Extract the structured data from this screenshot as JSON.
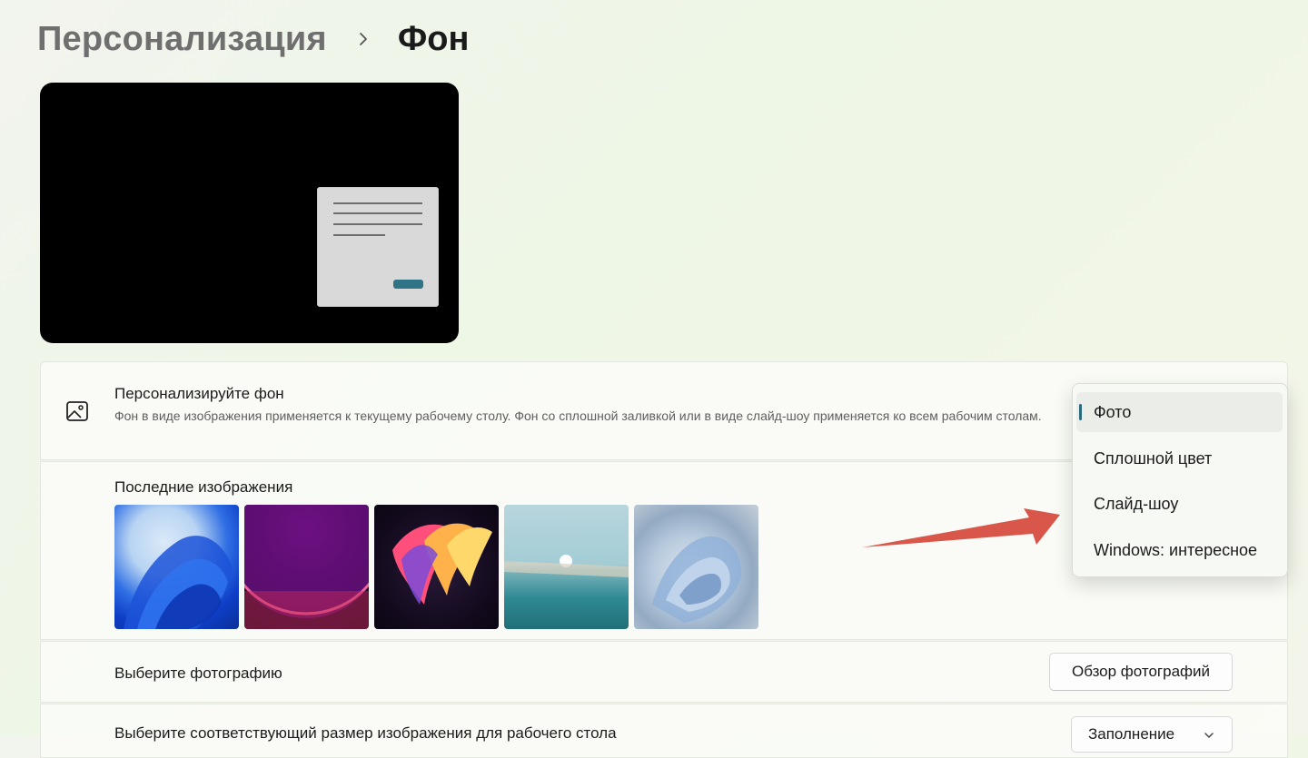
{
  "breadcrumb": {
    "parent": "Персонализация",
    "current": "Фон"
  },
  "personalize": {
    "title": "Персонализируйте фон",
    "description": "Фон в виде изображения применяется к текущему рабочему столу. Фон со сплошной заливкой или в виде слайд-шоу применяется ко всем рабочим столам.",
    "icon": "picture-icon"
  },
  "recent": {
    "title": "Последние изображения",
    "count": 5
  },
  "photo": {
    "label": "Выберите фотографию",
    "browse_label": "Обзор фотографий"
  },
  "fit": {
    "label": "Выберите соответствующий размер изображения для рабочего стола",
    "value": "Заполнение"
  },
  "dropdown": {
    "items": [
      {
        "label": "Фото",
        "selected": true
      },
      {
        "label": "Сплошной цвет",
        "selected": false
      },
      {
        "label": "Слайд-шоу",
        "selected": false
      },
      {
        "label": "Windows: интересное",
        "selected": false
      }
    ]
  },
  "colors": {
    "accent": "#2b6a7d",
    "arrow": "#d9574a",
    "preview_bg": "#000000"
  }
}
